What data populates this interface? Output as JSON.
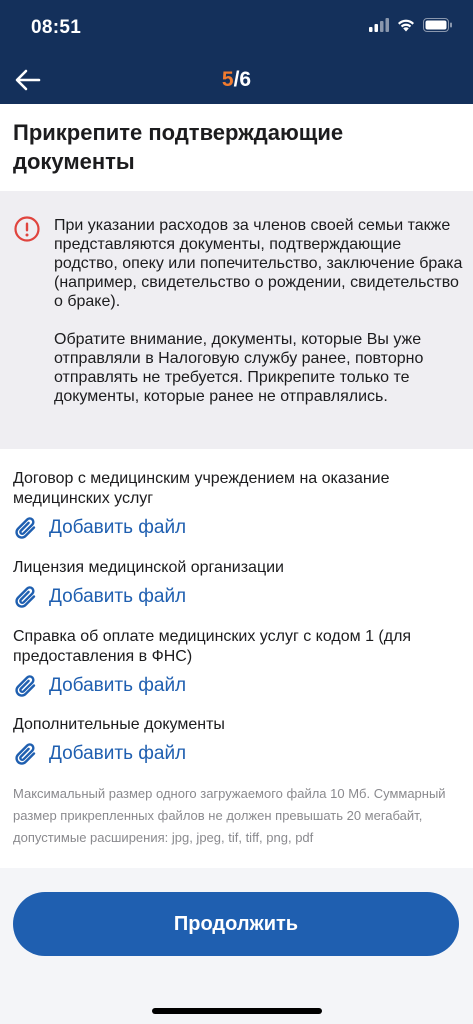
{
  "status_bar": {
    "time": "08:51"
  },
  "header": {
    "step_current": "5",
    "step_separator": "/",
    "step_total": "6"
  },
  "page": {
    "title": "Прикрепите подтверждающие документы"
  },
  "notice": {
    "paragraph1": "При указании расходов за членов своей семьи также представляются документы, подтверждающие родство, опеку или попечительство, заключение брака (например, свидетельство о рождении, свидетельство о браке).",
    "paragraph2": "Обратите внимание, документы, которые Вы уже отправляли в Налоговую службу ранее, повторно отправлять не требуется. Прикрепите только те документы, которые ранее не отправлялись."
  },
  "documents": [
    {
      "label": "Договор с медицинским учреждением на оказание медицинских услуг",
      "action": "Добавить файл"
    },
    {
      "label": "Лицензия медицинской организации",
      "action": "Добавить файл"
    },
    {
      "label": "Справка об оплате медицинских услуг с кодом 1 (для предоставления в ФНС)",
      "action": "Добавить файл"
    },
    {
      "label": "Дополнительные документы",
      "action": "Добавить файл"
    }
  ],
  "hint": "Максимальный размер одного загружаемого файла 10 Мб. Суммарный размер прикрепленных файлов не должен превышать 20 мегабайт, допустимые расширения: jpg, jpeg, tif, tiff, png, pdf",
  "footer": {
    "continue_label": "Продолжить"
  },
  "icons": {
    "back": "arrow-left-icon",
    "notice": "exclamation-circle-icon",
    "attach": "paperclip-icon",
    "signal": "signal-icon",
    "wifi": "wifi-icon",
    "battery": "battery-icon"
  },
  "colors": {
    "header_bg": "#14305b",
    "step_accent": "#f07b2f",
    "primary": "#1f5fb0",
    "notice_bg": "#efeef2",
    "notice_icon": "#e0443e"
  }
}
